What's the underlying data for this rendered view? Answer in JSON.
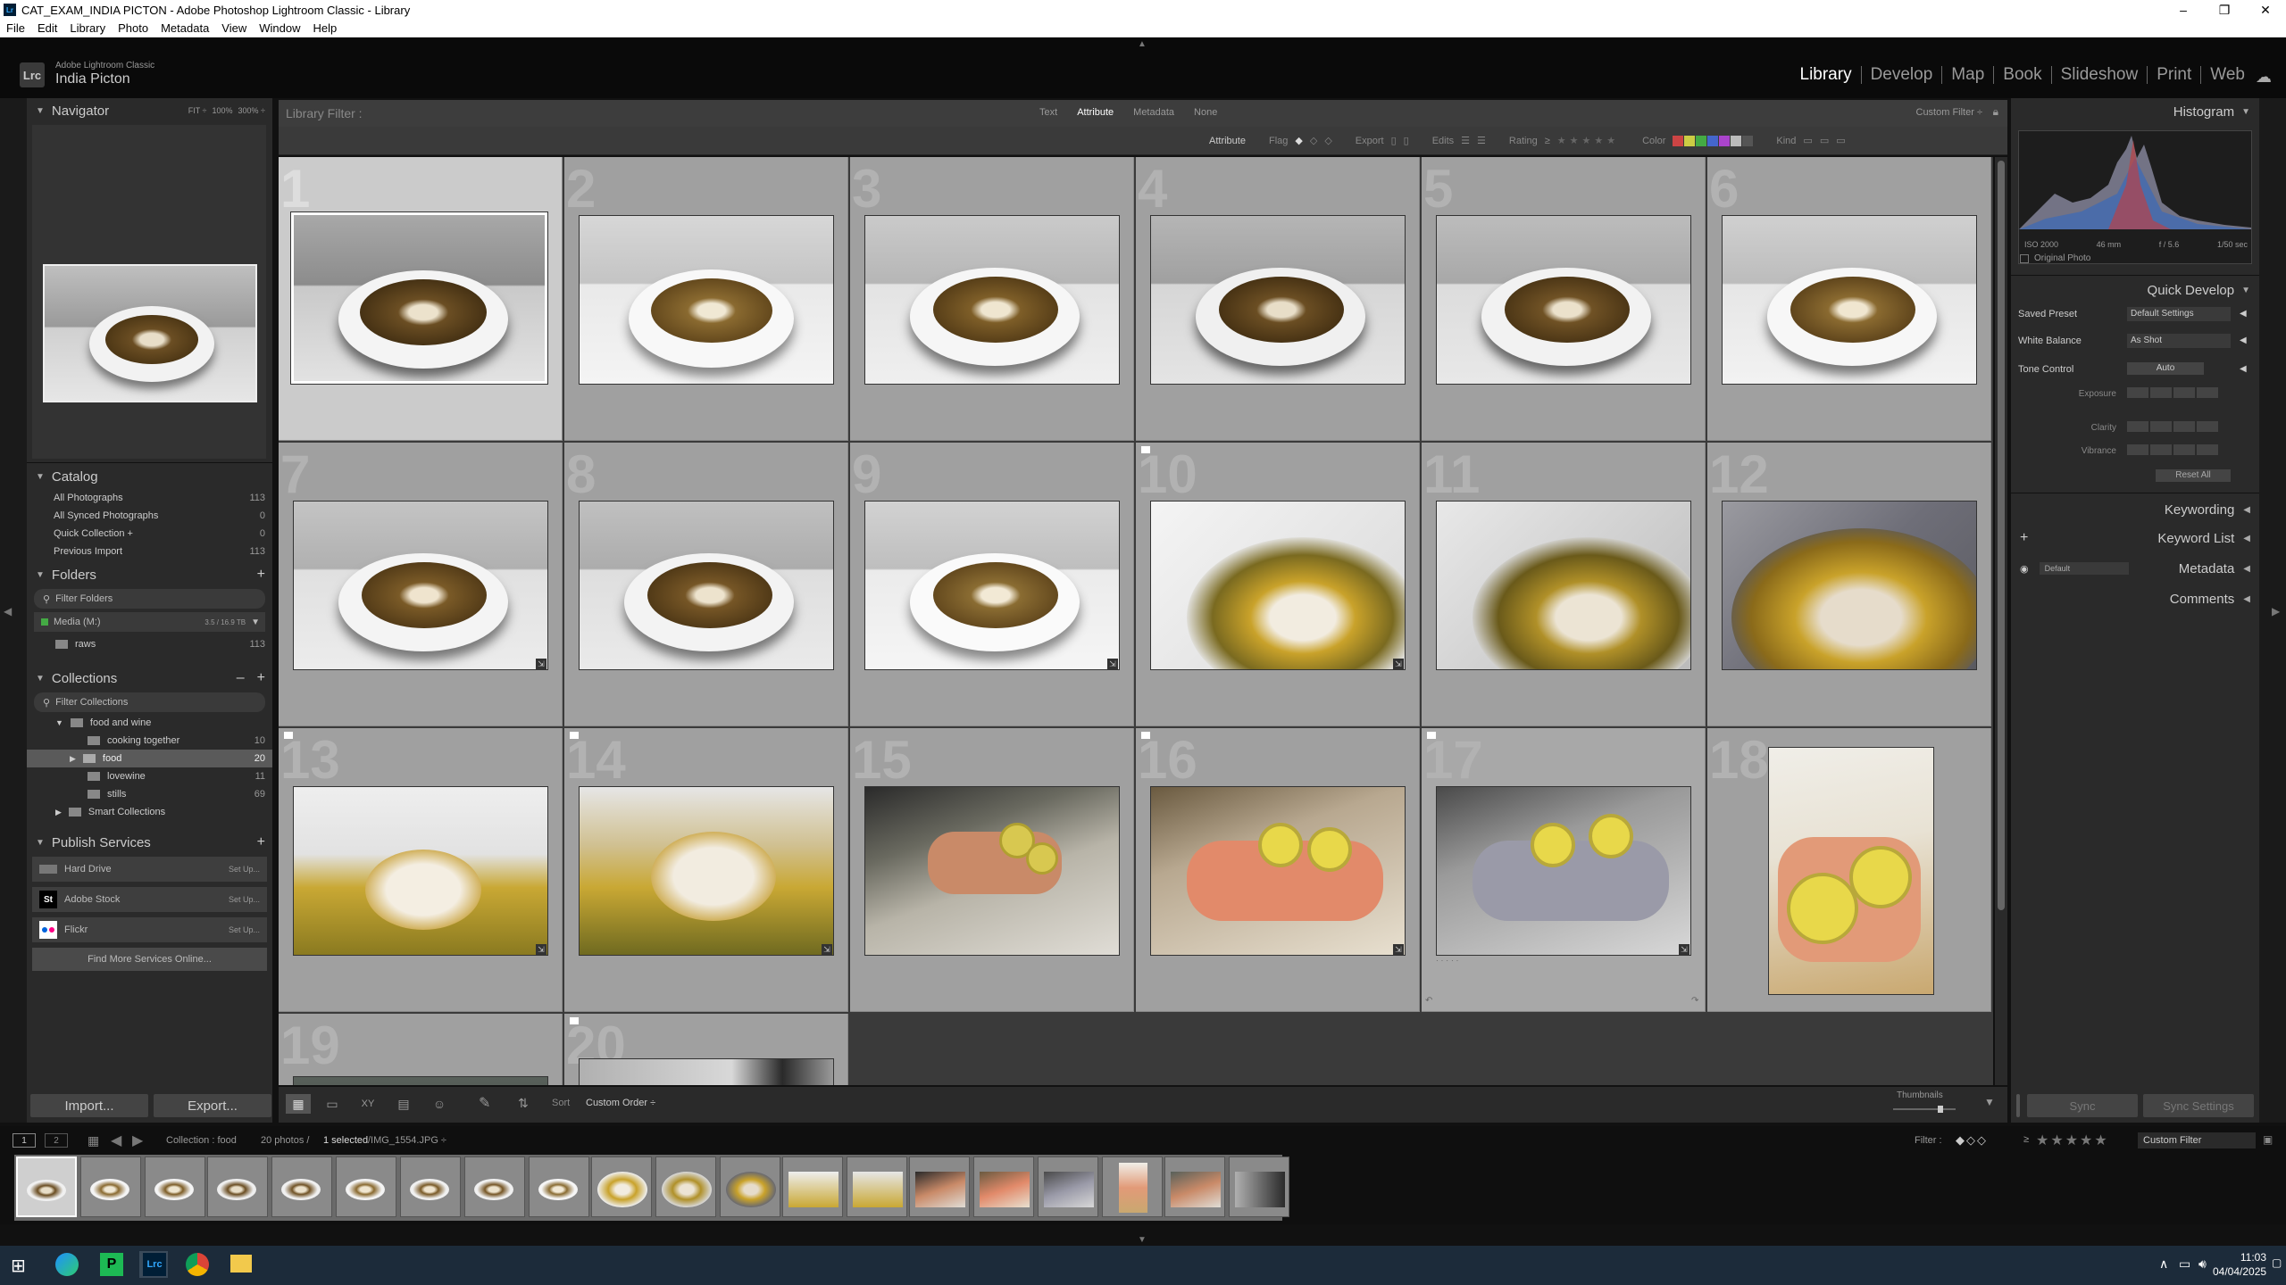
{
  "window": {
    "title": "CAT_EXAM_INDIA PICTON - Adobe Photoshop Lightroom Classic - Library"
  },
  "menu": [
    "File",
    "Edit",
    "Library",
    "Photo",
    "Metadata",
    "View",
    "Window",
    "Help"
  ],
  "identity": {
    "app": "Adobe Lightroom Classic",
    "catalog": "India Picton",
    "logo": "Lrc"
  },
  "modules": [
    "Library",
    "Develop",
    "Map",
    "Book",
    "Slideshow",
    "Print",
    "Web"
  ],
  "navigator": {
    "title": "Navigator",
    "zooms": [
      "FIT ÷",
      "100%",
      "300% ÷"
    ]
  },
  "catalog": {
    "title": "Catalog",
    "items": [
      {
        "label": "All Photographs",
        "count": "113"
      },
      {
        "label": "All Synced Photographs",
        "count": "0"
      },
      {
        "label": "Quick Collection +",
        "count": "0"
      },
      {
        "label": "Previous Import",
        "count": "113"
      }
    ]
  },
  "folders": {
    "title": "Folders",
    "filter": "Filter Folders",
    "volume": "Media (M:)",
    "volume_info": "3.5 / 16.9 TB",
    "items": [
      {
        "label": "raws",
        "count": "113"
      }
    ]
  },
  "collections": {
    "title": "Collections",
    "filter": "Filter Collections",
    "items": [
      {
        "label": "food and wine",
        "count": ""
      },
      {
        "label": "cooking together",
        "count": "10"
      },
      {
        "label": "food",
        "count": "20"
      },
      {
        "label": "lovewine",
        "count": "11"
      },
      {
        "label": "stills",
        "count": "69"
      },
      {
        "label": "Smart Collections",
        "count": ""
      }
    ]
  },
  "publish": {
    "title": "Publish Services",
    "items": [
      {
        "label": "Hard Drive",
        "action": "Set Up..."
      },
      {
        "label": "Adobe Stock",
        "action": "Set Up..."
      },
      {
        "label": "Flickr",
        "action": "Set Up..."
      }
    ],
    "more": "Find More Services Online..."
  },
  "buttons": {
    "import": "Import...",
    "export": "Export...",
    "sync": "Sync",
    "sync_settings": "Sync Settings"
  },
  "library_filter": {
    "title": "Library Filter :",
    "tabs": [
      "Text",
      "Attribute",
      "Metadata",
      "None"
    ],
    "custom": "Custom Filter ÷",
    "attr_label": "Attribute",
    "flag": "Flag",
    "export": "Export",
    "edits": "Edits",
    "rating": "Rating",
    "color": "Color",
    "kind": "Kind"
  },
  "grid": {
    "cells": [
      {
        "n": "1"
      },
      {
        "n": "2"
      },
      {
        "n": "3"
      },
      {
        "n": "4"
      },
      {
        "n": "5"
      },
      {
        "n": "6"
      },
      {
        "n": "7"
      },
      {
        "n": "8"
      },
      {
        "n": "9"
      },
      {
        "n": "10"
      },
      {
        "n": "11"
      },
      {
        "n": "12"
      },
      {
        "n": "13"
      },
      {
        "n": "14"
      },
      {
        "n": "15"
      },
      {
        "n": "16"
      },
      {
        "n": "17"
      },
      {
        "n": "18"
      },
      {
        "n": "19"
      },
      {
        "n": "20"
      }
    ]
  },
  "toolbar": {
    "sort_label": "Sort",
    "sort_value": "Custom Order ÷",
    "thumbs_label": "Thumbnails"
  },
  "histogram": {
    "title": "Histogram",
    "iso": "ISO 2000",
    "focal": "46 mm",
    "aperture": "f / 5.6",
    "shutter": "1/50 sec",
    "original": "Original Photo"
  },
  "quick_develop": {
    "title": "Quick Develop",
    "saved_preset": "Saved Preset",
    "saved_preset_value": "Default Settings",
    "white_balance": "White Balance",
    "white_balance_value": "As Shot",
    "tone_control": "Tone Control",
    "auto": "Auto",
    "exposure": "Exposure",
    "clarity": "Clarity",
    "vibrance": "Vibrance",
    "reset": "Reset All"
  },
  "right_sections": {
    "keywording": "Keywording",
    "keyword_list": "Keyword List",
    "metadata": "Metadata",
    "metadata_preset": "Default",
    "comments": "Comments"
  },
  "filmstrip": {
    "pages": [
      "1",
      "2"
    ],
    "source": "Collection : food",
    "count": "20 photos /",
    "selected": "1 selected",
    "file": "/IMG_1554.JPG ÷",
    "filter_label": "Filter :",
    "filter_value": "Custom Filter"
  },
  "taskbar": {
    "time": "11:03",
    "date": "04/04/2025"
  }
}
